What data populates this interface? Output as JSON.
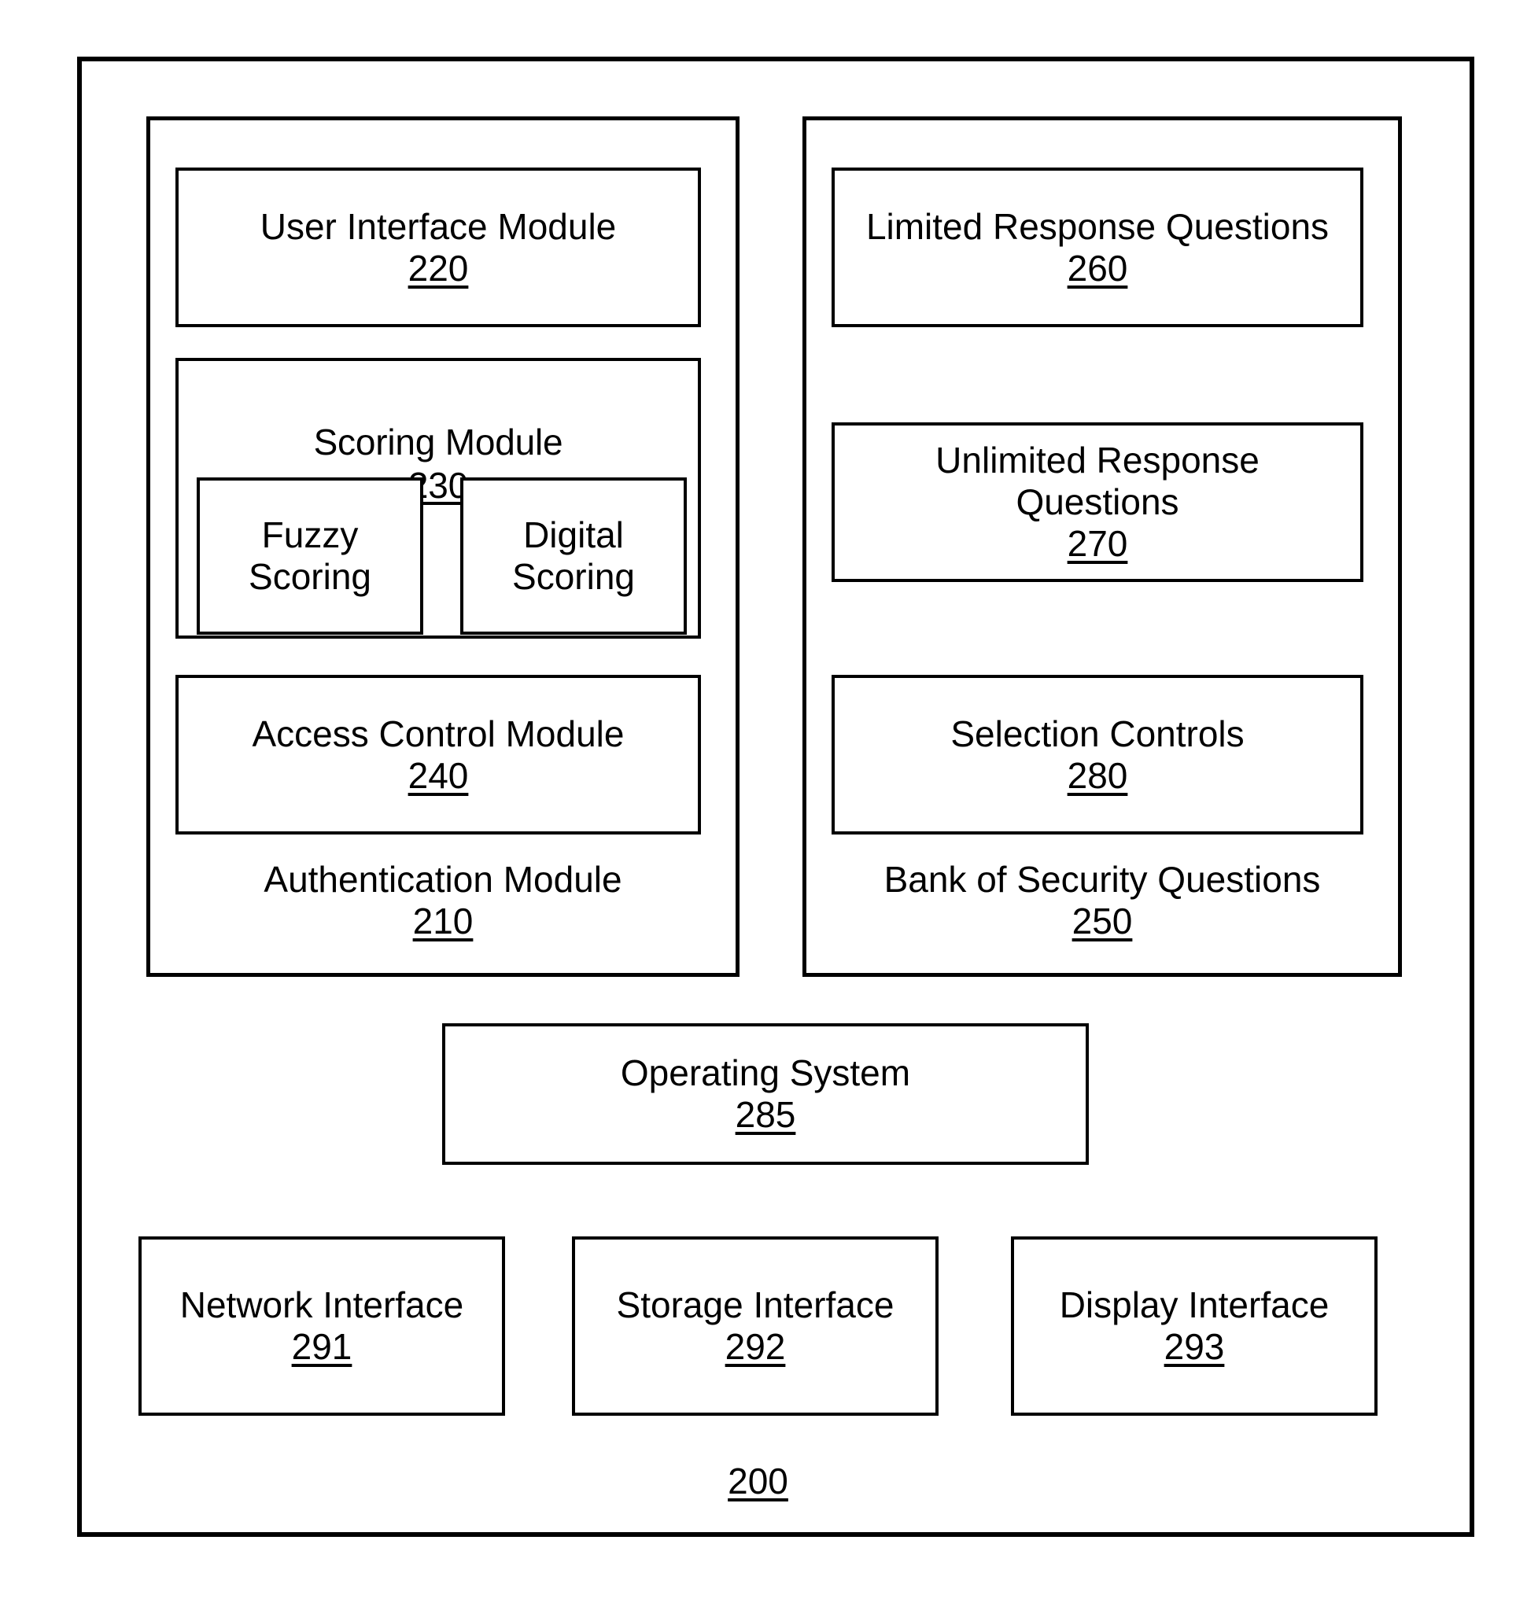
{
  "figure": {
    "number": "200",
    "description": "Block diagram of an authentication computing system"
  },
  "left_column": {
    "container": {
      "caption": "Authentication Module",
      "ref": "210"
    },
    "boxes": [
      {
        "title": "User Interface Module",
        "ref": "220"
      },
      {
        "title": "Scoring Module",
        "ref": "230"
      },
      {
        "title": "Access Control Module",
        "ref": "240"
      }
    ],
    "scoring_children": [
      {
        "title": "Fuzzy\nScoring",
        "ref": ""
      },
      {
        "title": "Digital\nScoring",
        "ref": ""
      }
    ]
  },
  "right_column": {
    "container": {
      "caption": "Bank of Security Questions",
      "ref": "250"
    },
    "boxes": [
      {
        "title": "Limited Response Questions",
        "ref": "260"
      },
      {
        "title": "Unlimited Response\nQuestions",
        "ref": "270"
      },
      {
        "title": "Selection Controls",
        "ref": "280"
      }
    ]
  },
  "operating_system": {
    "title": "Operating System",
    "ref": "285"
  },
  "interfaces": [
    {
      "title": "Network Interface",
      "ref": "291"
    },
    {
      "title": "Storage Interface",
      "ref": "292"
    },
    {
      "title": "Display Interface",
      "ref": "293"
    }
  ],
  "colors": {
    "stroke": "#000000",
    "background": "#ffffff",
    "text": "#000000"
  }
}
